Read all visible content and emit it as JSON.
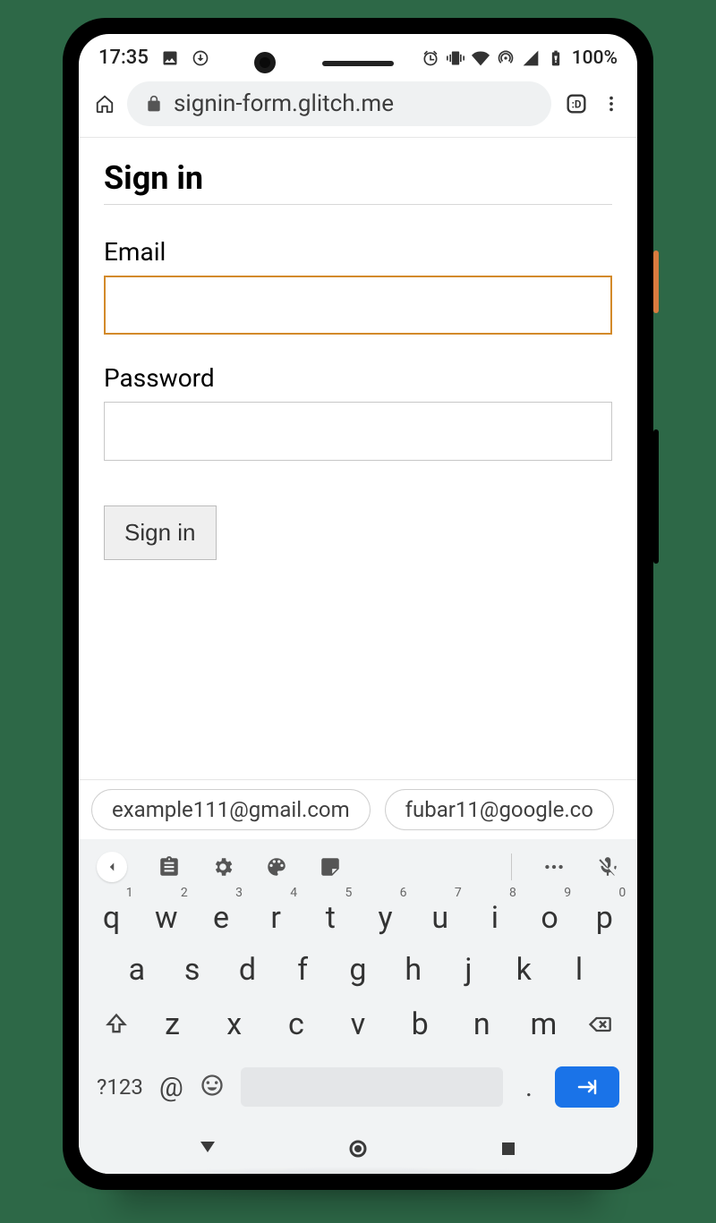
{
  "status": {
    "time": "17:35",
    "battery_text": "100%"
  },
  "browser": {
    "url_text": "signin-form.glitch.me"
  },
  "form": {
    "title": "Sign in",
    "email_label": "Email",
    "password_label": "Password",
    "submit_label": "Sign in"
  },
  "suggestions": [
    "example111@gmail.com",
    "fubar11@google.co"
  ],
  "keyboard": {
    "row1": [
      {
        "k": "q",
        "n": "1"
      },
      {
        "k": "w",
        "n": "2"
      },
      {
        "k": "e",
        "n": "3"
      },
      {
        "k": "r",
        "n": "4"
      },
      {
        "k": "t",
        "n": "5"
      },
      {
        "k": "y",
        "n": "6"
      },
      {
        "k": "u",
        "n": "7"
      },
      {
        "k": "i",
        "n": "8"
      },
      {
        "k": "o",
        "n": "9"
      },
      {
        "k": "p",
        "n": "0"
      }
    ],
    "row2": [
      "a",
      "s",
      "d",
      "f",
      "g",
      "h",
      "j",
      "k",
      "l"
    ],
    "row3": [
      "z",
      "x",
      "c",
      "v",
      "b",
      "n",
      "m"
    ],
    "sym": "?123",
    "at": "@",
    "dot": "."
  }
}
